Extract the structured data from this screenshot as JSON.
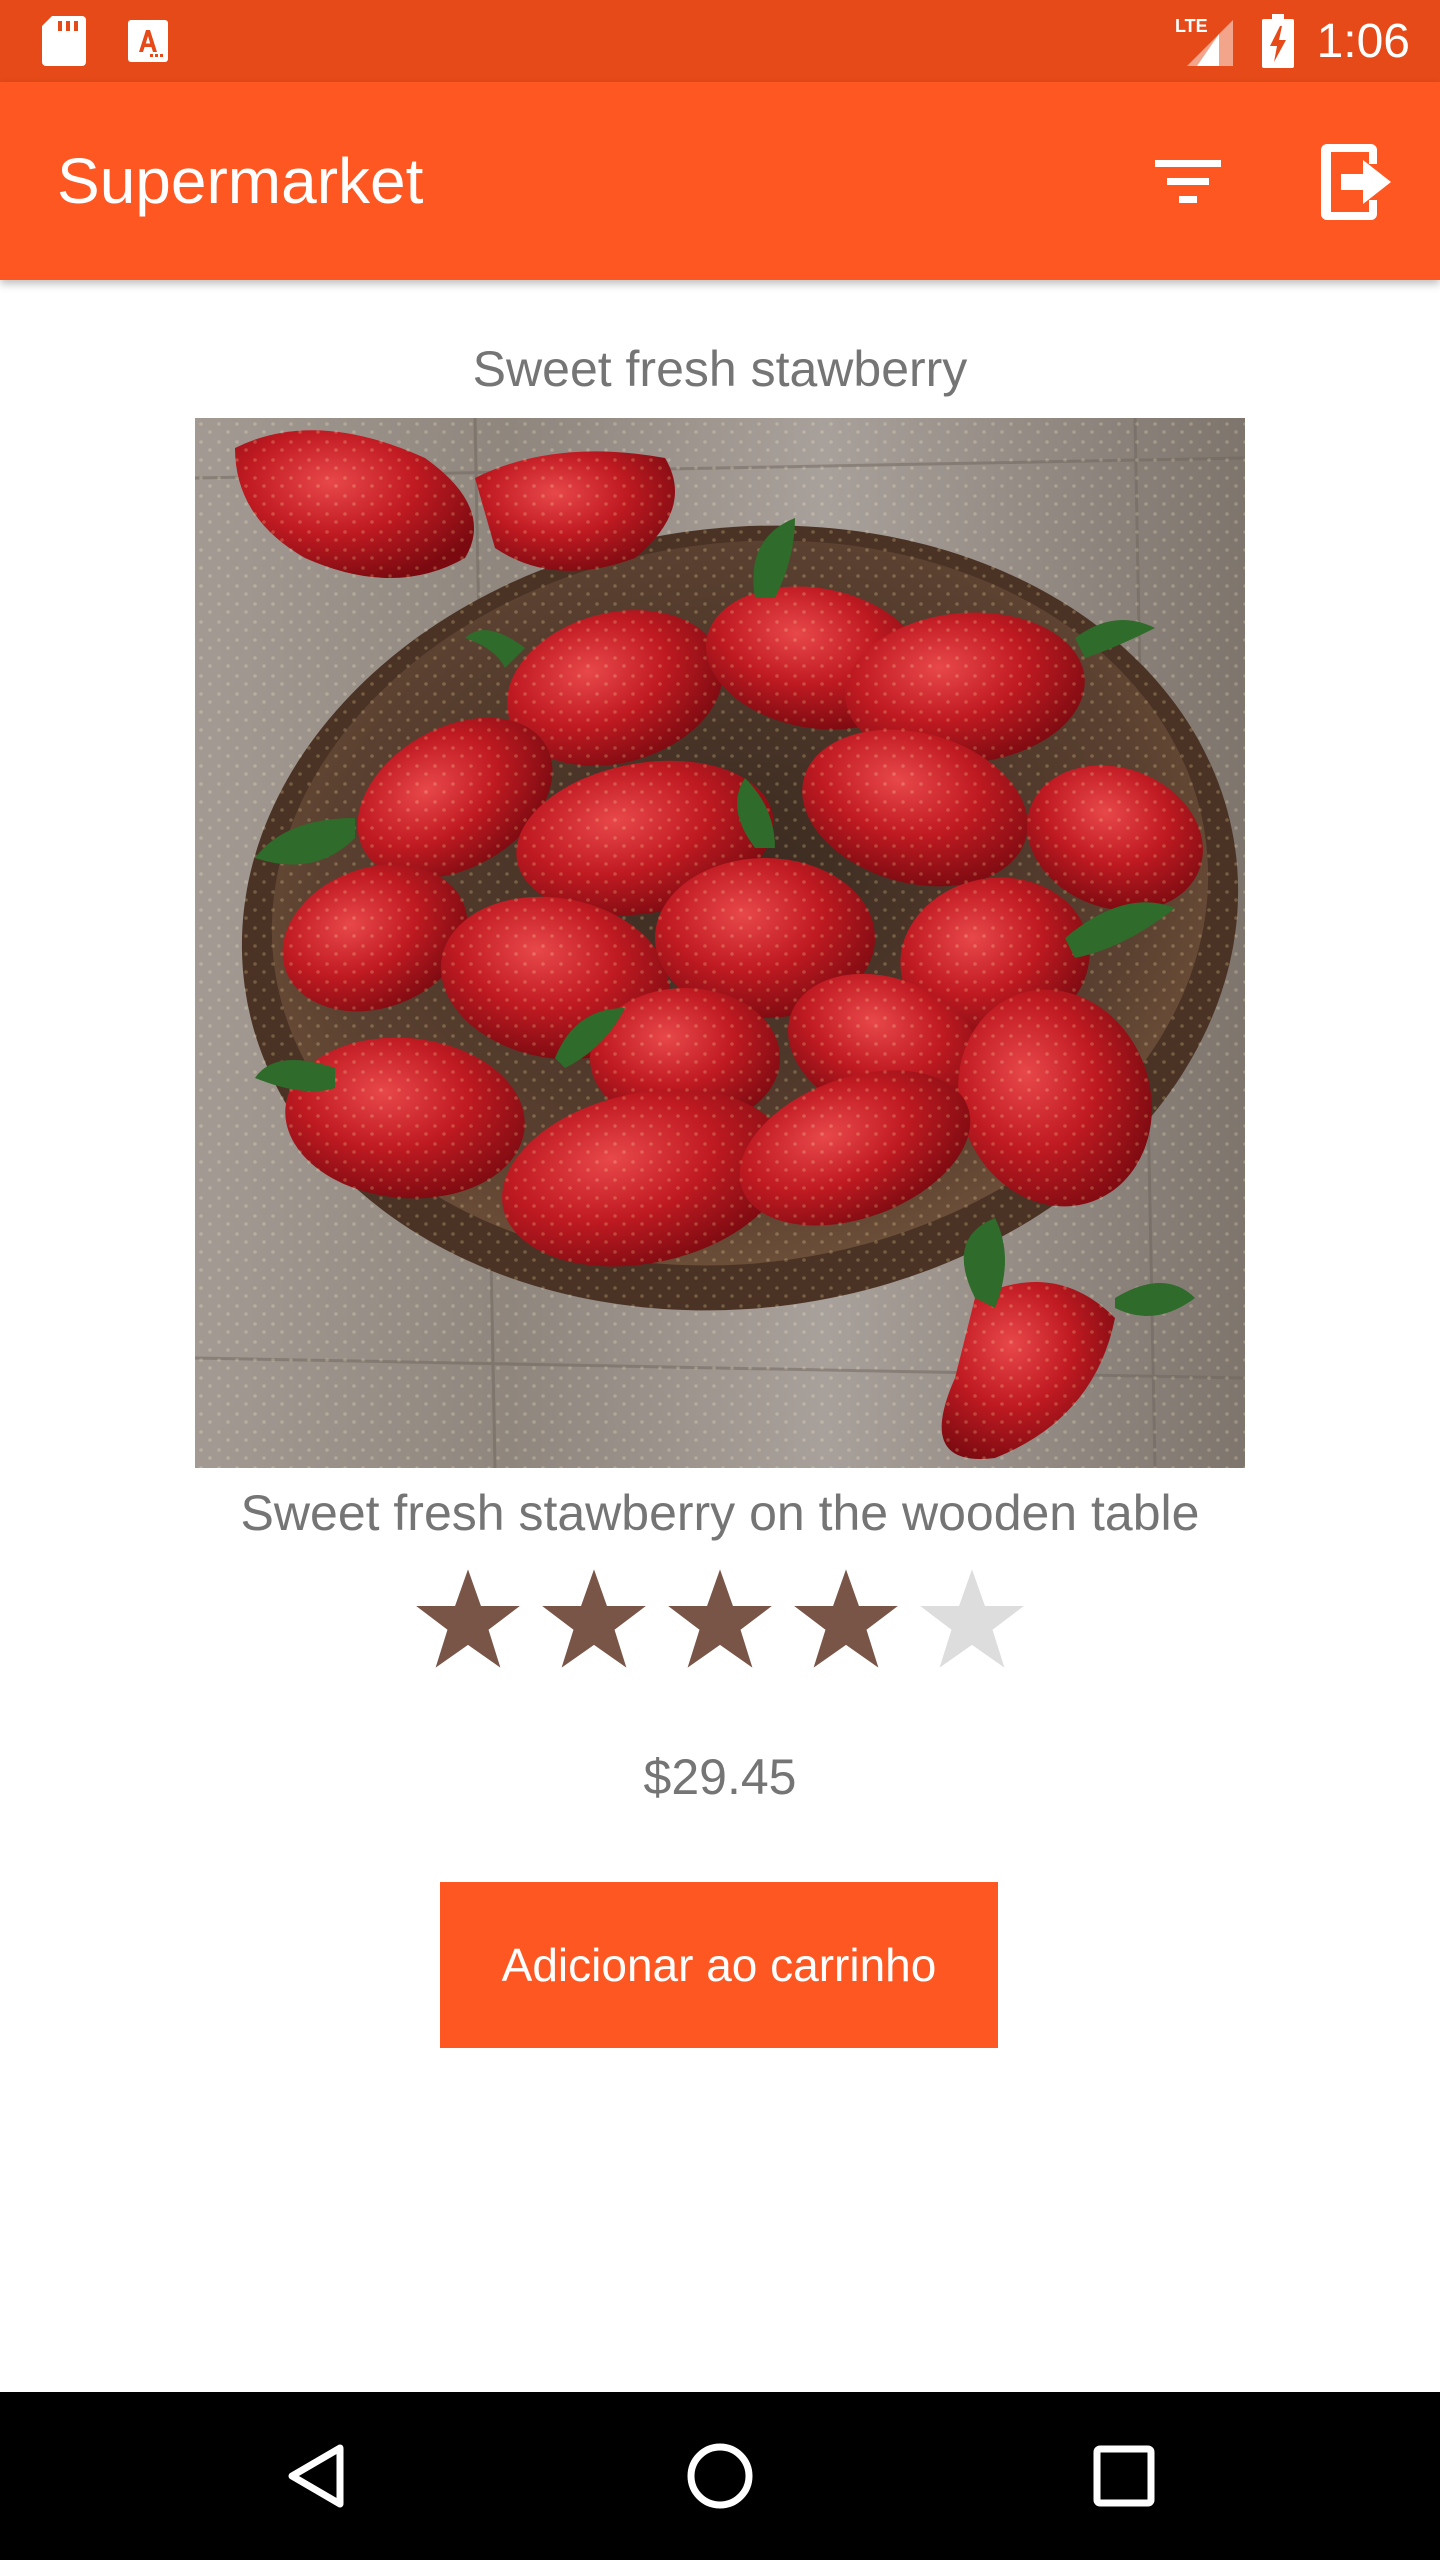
{
  "status_bar": {
    "time": "1:06",
    "network": "LTE",
    "icons": [
      "sd-card-icon",
      "font-app-icon",
      "lte-signal-icon",
      "battery-charging-icon"
    ]
  },
  "app_bar": {
    "title": "Supermarket",
    "actions": [
      "filter-icon",
      "logout-icon"
    ]
  },
  "product": {
    "name": "Sweet fresh stawberry",
    "image_alt": "strawberries in a wooden bowl",
    "description": "Sweet fresh stawberry on the wooden table",
    "rating": 4,
    "rating_max": 5,
    "price": "$29.45",
    "add_to_cart_label": "Adicionar ao carrinho"
  },
  "nav_bar": {
    "buttons": [
      "back-icon",
      "home-icon",
      "recents-icon"
    ]
  },
  "colors": {
    "status_bar": "#E64A19",
    "app_bar": "#FF5722",
    "accent": "#FF5722",
    "star_filled": "#795548",
    "star_empty": "#DDDDDD",
    "text_secondary": "#757575"
  }
}
